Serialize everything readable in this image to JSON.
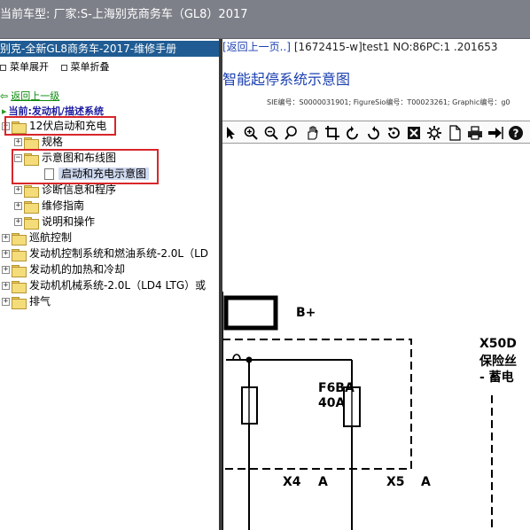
{
  "window": {
    "car_title": "当前车型:  厂家:S-上海别克商务车（GL8）2017"
  },
  "left_panel": {
    "header": "别克-全新GL8商务车-2017-维修手册",
    "menu": {
      "expand": "菜单展开",
      "collapse": "菜单折叠"
    },
    "back_link": "返回上一级",
    "current_path": "当前:发动机/描述系统",
    "tree": [
      {
        "label": "12伏启动和充电",
        "expander": "−"
      },
      {
        "label": "规格",
        "expander": "+"
      },
      {
        "label": "示意图和布线图",
        "expander": "−"
      },
      {
        "label": "启动和充电示意图",
        "expander": ""
      },
      {
        "label": "诊断信息和程序",
        "expander": "+"
      },
      {
        "label": "维修指南",
        "expander": "+"
      },
      {
        "label": "说明和操作",
        "expander": "+"
      },
      {
        "label": "巡航控制",
        "expander": "+"
      },
      {
        "label": "发动机控制系统和燃油系统-2.0L（LD",
        "expander": "+"
      },
      {
        "label": "发动机的加热和冷却",
        "expander": "+"
      },
      {
        "label": "发动机机械系统-2.0L（LD4 LTG）或",
        "expander": "+"
      },
      {
        "label": "排气",
        "expander": "+"
      }
    ]
  },
  "right_panel": {
    "nav_back": "[返回上一页..]",
    "nav_info": "[1672415-w]test1 NO:86PC:1 .201653",
    "title": "智能起停系统示意图",
    "ids": "SIE编号：S0000031901; FigureSio编号：T00023261; Graphic编号：g0",
    "toolbar": [
      "pointer-icon",
      "zoom-in-icon",
      "zoom-out-icon",
      "find-icon",
      "pan-icon",
      "crop-icon",
      "rotate-left-icon",
      "rotate-right-icon",
      "reset-icon",
      "fit-icon",
      "settings-icon",
      "page-icon",
      "print-icon",
      "export-icon",
      "help-icon"
    ],
    "diagram": {
      "labels": {
        "battery_pos": "B+",
        "fuse_id": "F6BA",
        "fuse_rating": "40A",
        "x4": "X4",
        "x4_pin": "A",
        "x5": "X5",
        "x5_pin": "A",
        "x50d": "X50D",
        "fuse_box_text": "保险丝",
        "location_text": "- 蓄电"
      }
    }
  }
}
